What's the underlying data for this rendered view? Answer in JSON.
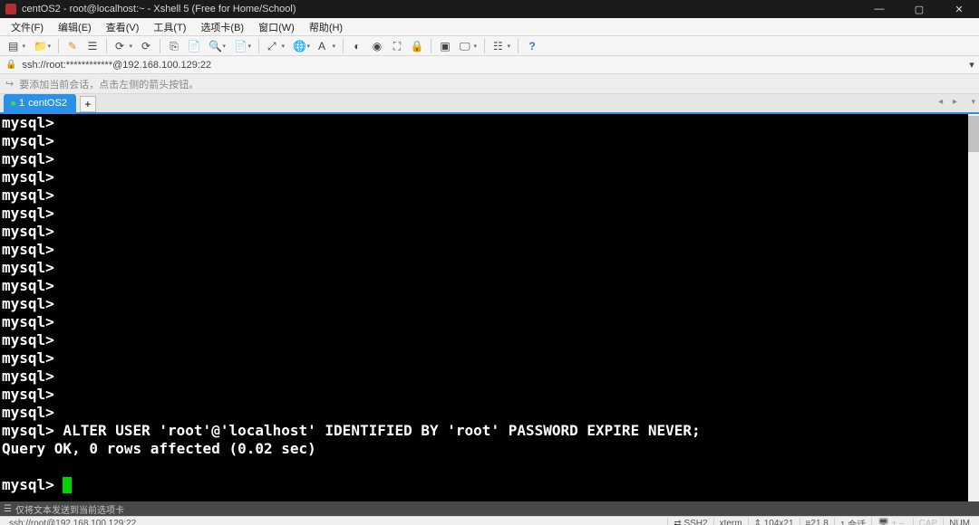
{
  "title": "centOS2 - root@localhost:~ - Xshell 5 (Free for Home/School)",
  "menus": [
    "文件(F)",
    "编辑(E)",
    "查看(V)",
    "工具(T)",
    "选项卡(B)",
    "窗口(W)",
    "帮助(H)"
  ],
  "address": {
    "text": "ssh://root:************@192.168.100.129:22"
  },
  "hint": "要添加当前会话，点击左侧的箭头按钮。",
  "tab": {
    "index": "1",
    "label": "centOS2"
  },
  "terminal": {
    "prompt": "mysql>",
    "empty_count": 17,
    "cmd": "ALTER USER 'root'@'localhost' IDENTIFIED BY 'root' PASSWORD EXPIRE NEVER;",
    "result": "Query OK, 0 rows affected (0.02 sec)"
  },
  "sendhint": "仅将文本发送到当前选项卡",
  "status": {
    "conn": "ssh://root@192.168.100.129:22",
    "ssh": "SSH2",
    "term": "xterm",
    "size": "104x21",
    "cursor": "21,8",
    "sessions": "1 会话",
    "cap": "CAP",
    "num": "NUM"
  },
  "glyph": {
    "new": "▤",
    "open": "📁",
    "edit": "✎",
    "props": "☰",
    "refresh": "⟳",
    "copy": "⎘",
    "paste": "📄",
    "search": "🔍",
    "zoom": "⤢",
    "font": "A",
    "globe": "🌐",
    "textA": "Aᵢ",
    "circle": "◐",
    "mic": "◉",
    "expand": "⛶",
    "lockico": "🔒",
    "rec": "▣",
    "screen": "🖵",
    "list": "☷",
    "help": "?",
    "lock": "🔒",
    "hintico": "↪",
    "plus": "+",
    "min": "—",
    "max": "▢",
    "close": "✕",
    "sendico": "☰",
    "link": "⇄",
    "pc": "🖥",
    "updown": "⇕"
  }
}
